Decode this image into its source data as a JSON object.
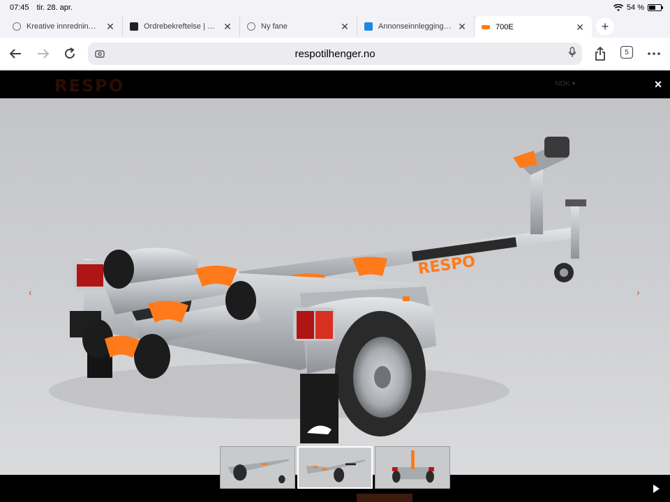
{
  "status": {
    "time": "07:45",
    "date": "tir. 28. apr.",
    "battery": "54 %",
    "battery_level": 0.54
  },
  "tabs": [
    {
      "title": "Kreative innredningsideer",
      "active": false
    },
    {
      "title": "Ordrebekreftelse | Mega",
      "active": false
    },
    {
      "title": "Ny fane",
      "active": false
    },
    {
      "title": "Annonseinnlegging | FINN",
      "active": false
    },
    {
      "title": "700E",
      "active": true
    }
  ],
  "toolbar": {
    "url": "respotilhenger.no",
    "tab_count": "5"
  },
  "site": {
    "logo": "RESPO",
    "header_right": "NOK ▾"
  },
  "lightbox": {
    "prev_arrow": "‹",
    "next_arrow": "›",
    "close": "×",
    "trailer_brand": "RESPO",
    "thumbnails": [
      {
        "active": false
      },
      {
        "active": true
      },
      {
        "active": false
      }
    ]
  },
  "colors": {
    "accent": "#ff7a1a",
    "chrome": "#f2f2f7"
  }
}
